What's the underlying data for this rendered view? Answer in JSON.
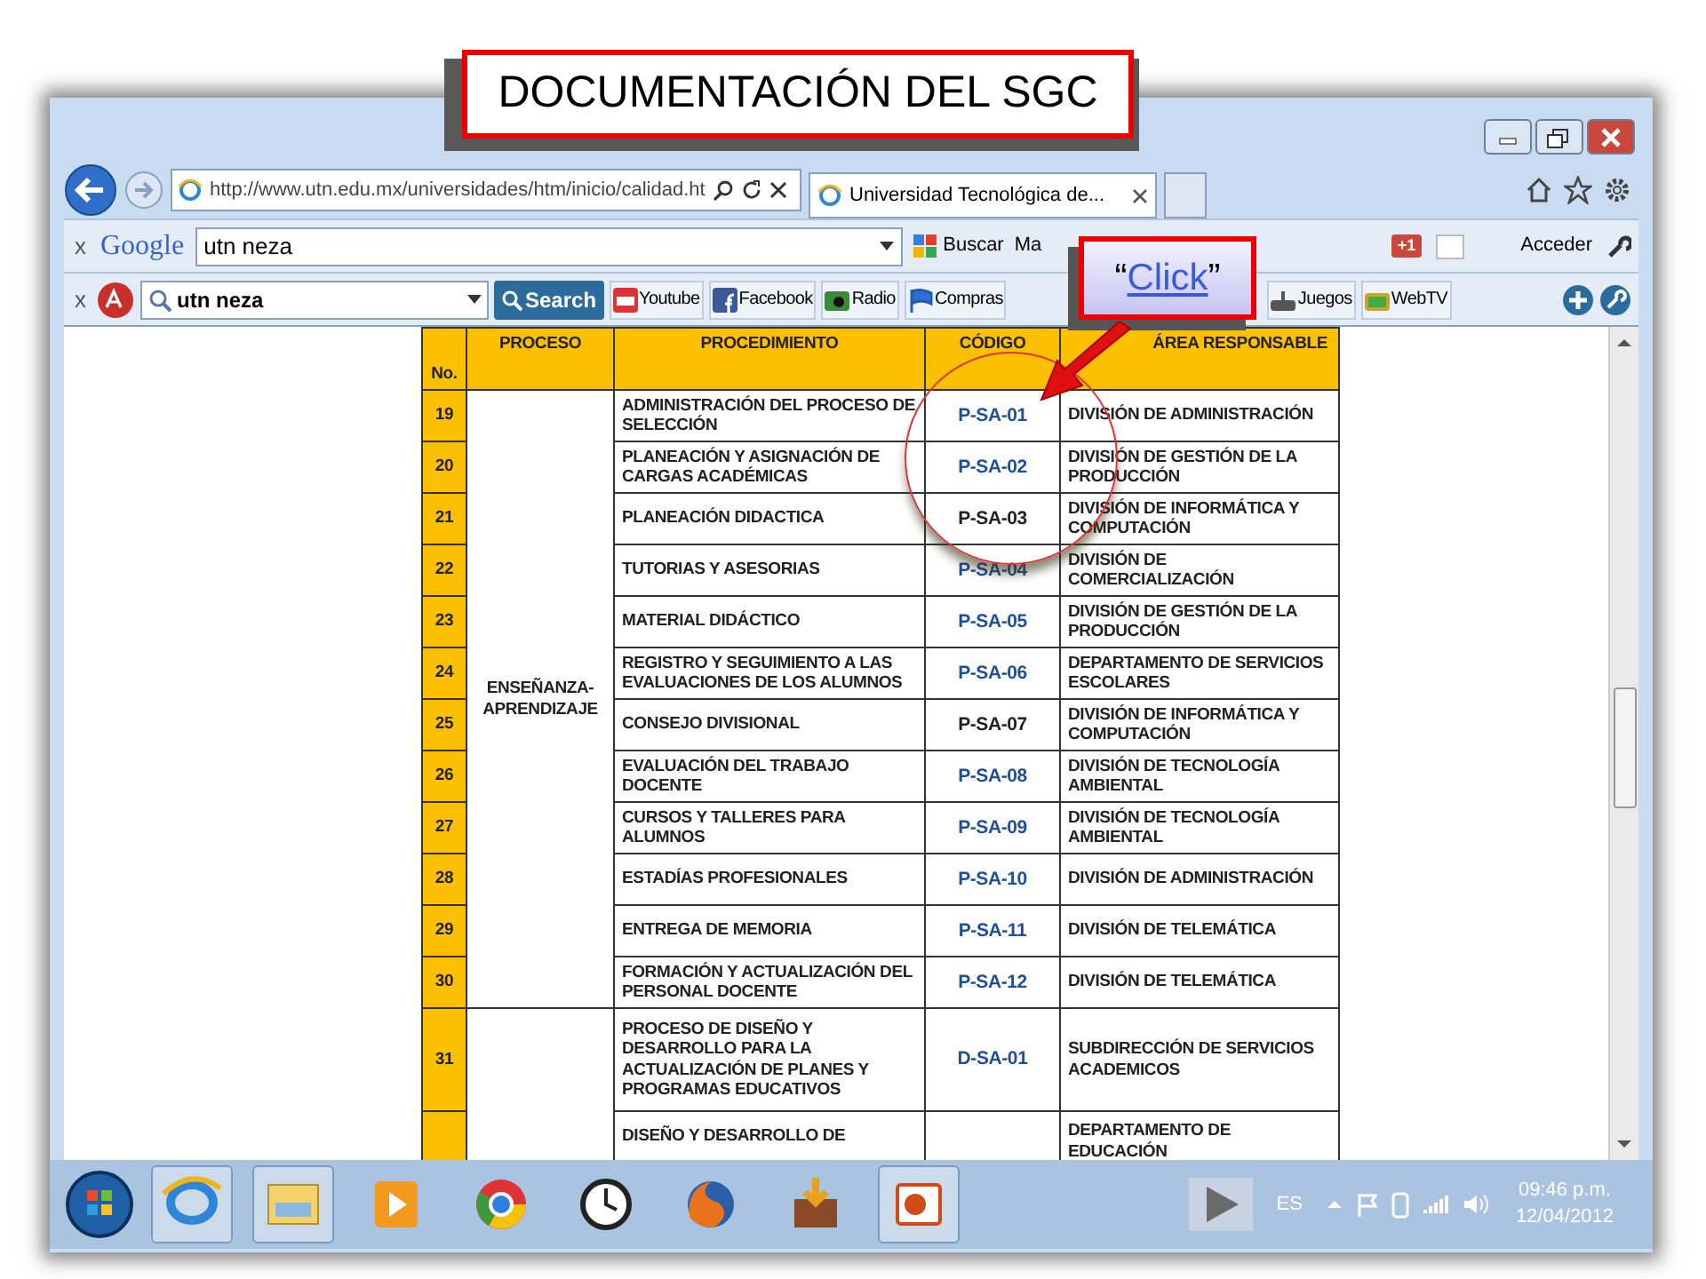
{
  "slide_title": "DOCUMENTACIÓN DEL SGC",
  "callout": {
    "open_quote": "“",
    "link": "Click",
    "close_quote": "”"
  },
  "browser": {
    "url": "http://www.utn.edu.mx/universidades/htm/inicio/calidad.ht",
    "tab_title": "Universidad Tecnológica de...",
    "google_toolbar": {
      "close": "x",
      "logo": "Google",
      "query": "utn neza",
      "search_button": "Buscar",
      "cut_item": "Ma",
      "plus_one": "+1",
      "sign_in": "Acceder"
    },
    "ask_toolbar": {
      "close": "x",
      "query": "utn neza",
      "search_button": "Search",
      "links": [
        {
          "label": "Youtube",
          "kind": "video"
        },
        {
          "label": "Facebook",
          "kind": "social"
        },
        {
          "label": "Radio",
          "kind": "radio"
        },
        {
          "label": "Compras",
          "kind": "shopping"
        },
        {
          "label": "Juegos",
          "kind": "games"
        },
        {
          "label": "WebTV",
          "kind": "tv"
        }
      ]
    }
  },
  "table": {
    "columns": [
      "No.",
      "PROCESO",
      "PROCEDIMIENTO",
      "CÓDIGO",
      "ÁREA RESPONSABLE"
    ],
    "groups": [
      {
        "proceso": "ENSEÑANZA-APRENDIZAJE",
        "rows": [
          {
            "no": "19",
            "procedimiento": "ADMINISTRACIÓN DEL PROCESO DE SELECCIÓN",
            "codigo": "P-SA-01",
            "linked": true,
            "area": "DIVISIÓN DE ADMINISTRACIÓN"
          },
          {
            "no": "20",
            "procedimiento": "PLANEACIÓN Y ASIGNACIÓN DE CARGAS ACADÉMICAS",
            "codigo": "P-SA-02",
            "linked": true,
            "area": "DIVISIÓN DE GESTIÓN DE LA PRODUCCIÓN"
          },
          {
            "no": "21",
            "procedimiento": "PLANEACIÓN DIDACTICA",
            "codigo": "P-SA-03",
            "linked": false,
            "area": "DIVISIÓN DE INFORMÁTICA Y COMPUTACIÓN"
          },
          {
            "no": "22",
            "procedimiento": "TUTORIAS Y ASESORIAS",
            "codigo": "P-SA-04",
            "linked": true,
            "area": "DIVISIÓN DE COMERCIALIZACIÓN"
          },
          {
            "no": "23",
            "procedimiento": "MATERIAL DIDÁCTICO",
            "codigo": "P-SA-05",
            "linked": true,
            "area": "DIVISIÓN DE GESTIÓN DE LA PRODUCCIÓN"
          },
          {
            "no": "24",
            "procedimiento": "REGISTRO Y SEGUIMIENTO A LAS EVALUACIONES DE LOS ALUMNOS",
            "codigo": "P-SA-06",
            "linked": true,
            "area": "DEPARTAMENTO DE SERVICIOS ESCOLARES"
          },
          {
            "no": "25",
            "procedimiento": "CONSEJO DIVISIONAL",
            "codigo": "P-SA-07",
            "linked": false,
            "area": "DIVISIÓN DE INFORMÁTICA Y COMPUTACIÓN"
          },
          {
            "no": "26",
            "procedimiento": "EVALUACIÓN DEL TRABAJO DOCENTE",
            "codigo": "P-SA-08",
            "linked": true,
            "area": "DIVISIÓN DE TECNOLOGÍA AMBIENTAL"
          },
          {
            "no": "27",
            "procedimiento": "CURSOS Y TALLERES PARA ALUMNOS",
            "codigo": "P-SA-09",
            "linked": true,
            "area": "DIVISIÓN DE TECNOLOGÍA AMBIENTAL"
          },
          {
            "no": "28",
            "procedimiento": "ESTADÍAS PROFESIONALES",
            "codigo": "P-SA-10",
            "linked": true,
            "area": "DIVISIÓN DE ADMINISTRACIÓN"
          },
          {
            "no": "29",
            "procedimiento": "ENTREGA DE MEMORIA",
            "codigo": "P-SA-11",
            "linked": true,
            "area": "DIVISIÓN DE TELEMÁTICA"
          },
          {
            "no": "30",
            "procedimiento": "FORMACIÓN Y ACTUALIZACIÓN DEL PERSONAL DOCENTE",
            "codigo": "P-SA-12",
            "linked": true,
            "area": "DIVISIÓN DE TELEMÁTICA"
          }
        ]
      },
      {
        "rows": [
          {
            "no": "31",
            "procedimiento": "PROCESO DE DISEÑO Y DESARROLLO PARA LA ACTUALIZACIÓN DE PLANES Y PROGRAMAS EDUCATIVOS",
            "codigo": "D-SA-01",
            "linked": true,
            "area": "SUBDIRECCIÓN DE SERVICIOS ACADEMICOS"
          },
          {
            "procedimiento": "DISEÑO Y DESARROLLO DE",
            "area": "DEPARTAMENTO DE EDUCACIÓN"
          }
        ]
      }
    ]
  },
  "taskbar": {
    "language": "ES",
    "time": "09:46 p.m.",
    "date": "12/04/2012"
  }
}
